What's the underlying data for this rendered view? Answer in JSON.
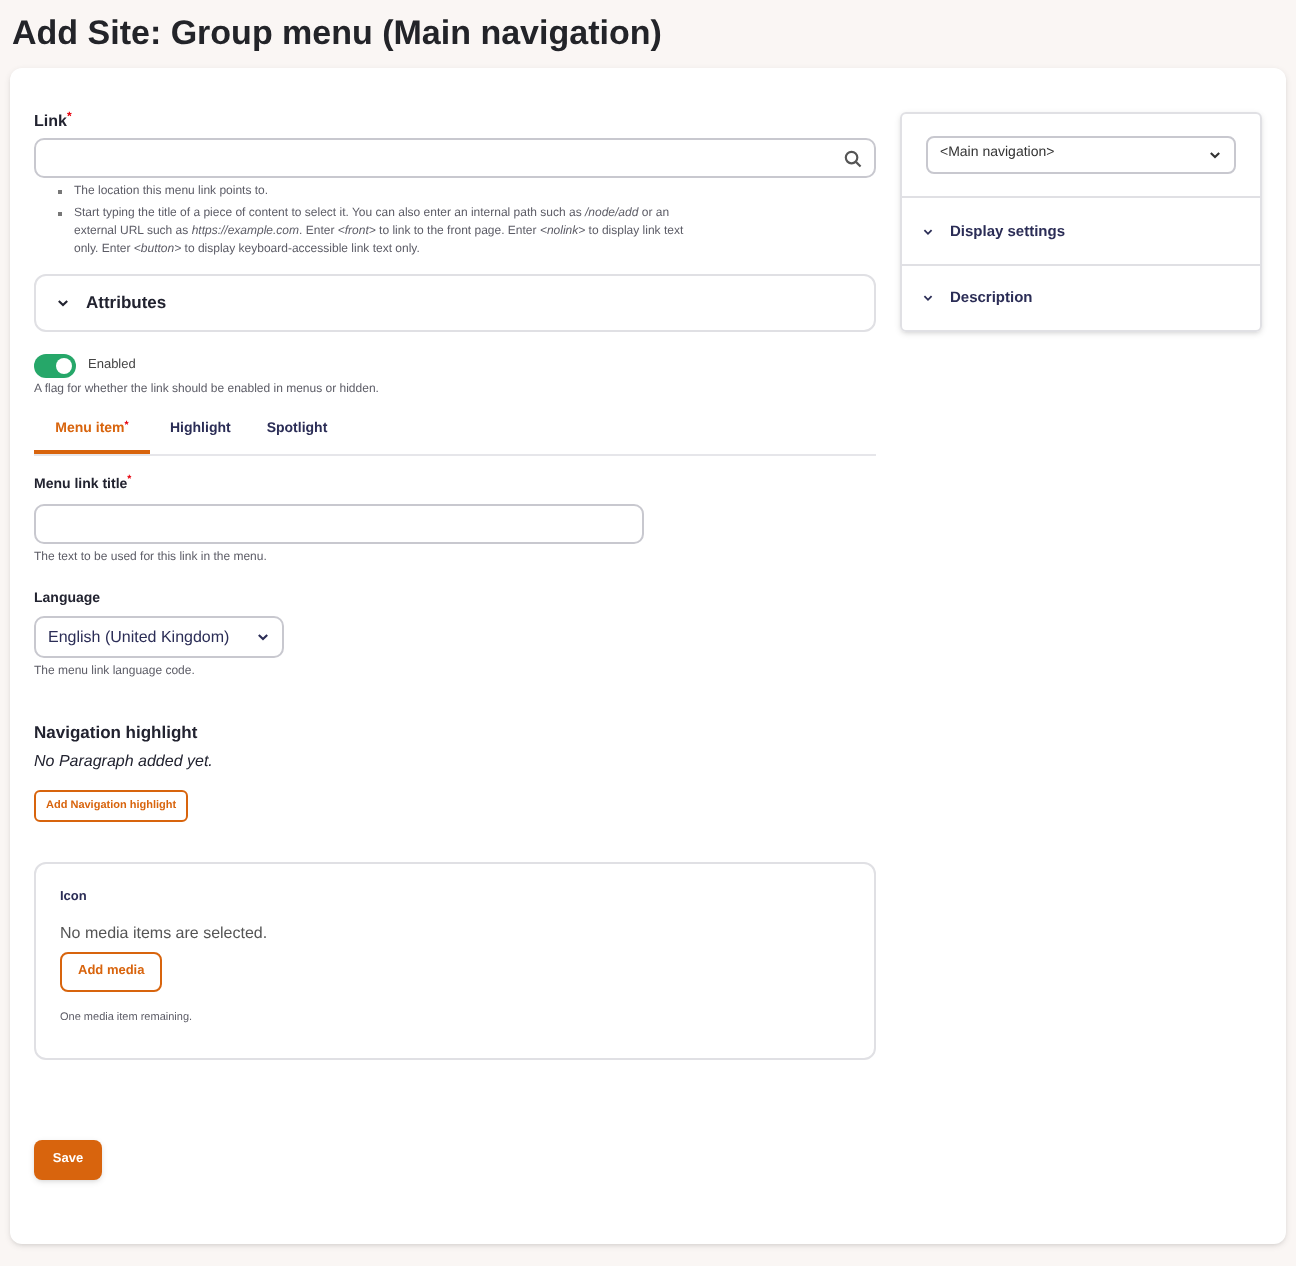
{
  "page_title": "Add Site: Group menu (Main navigation)",
  "link": {
    "label": "Link$^{*}$",
    "help": [
      "The location this menu link points to.",
      "Start typing the title of a piece of content to select it. You can also enter an internal path such as */node/add* or an external URL such as *https://example.com*. Enter *<front>* to link to the front page. Enter *<nolink>* to display link text only. Enter *<button>* to display keyboard-accessible link text only."
    ]
  },
  "attributes": {
    "label": "Attributes",
    "expanded": false
  },
  "enabled": {
    "label": "Enabled",
    "on": true,
    "help": "A flag for whether the link should be enabled in menus or hidden."
  },
  "tabs": [
    {
      "label": "Menu item$^{*}$",
      "selected": true
    },
    {
      "label": "Highlight",
      "selected": false
    },
    {
      "label": "Spotlight",
      "selected": false
    }
  ],
  "menu_link_title": {
    "label": "Menu link title$^{*}$",
    "help": "The text to be used for this link in the menu."
  },
  "language": {
    "label": "Language",
    "value": "English (United Kingdom)",
    "help": "The menu link language code."
  },
  "navigation_highlight": {
    "heading": "Navigation highlight",
    "empty": "No Paragraph added yet.",
    "button": "Add Navigation highlight"
  },
  "icon": {
    "label": "Icon",
    "empty": "No media items are selected.",
    "button": "Add media",
    "help": "One media item remaining."
  },
  "save": "Save",
  "sidebar": {
    "menu": "<Main navigation>",
    "sections": [
      {
        "label": "Display settings",
        "expanded": false
      },
      {
        "label": "Description",
        "expanded": false
      }
    ]
  }
}
